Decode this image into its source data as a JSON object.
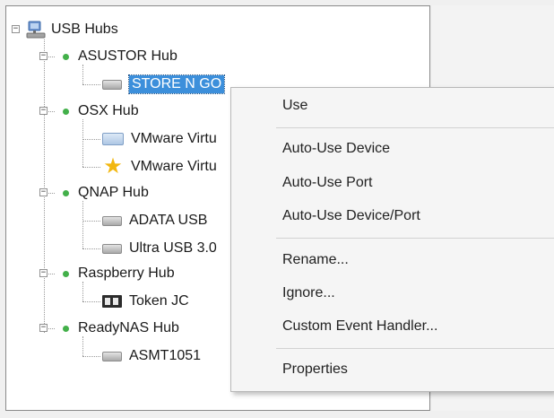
{
  "tree": {
    "root": {
      "label": "USB Hubs"
    },
    "hubs": [
      {
        "label": "ASUSTOR Hub",
        "devices": [
          {
            "label": "STORE N GO",
            "icon": "drive-icon",
            "selected": true
          }
        ]
      },
      {
        "label": "OSX Hub",
        "devices": [
          {
            "label": "VMware Virtu",
            "icon": "vm-icon"
          },
          {
            "label": "VMware Virtu",
            "icon": "star-icon"
          }
        ]
      },
      {
        "label": "QNAP Hub",
        "devices": [
          {
            "label": "ADATA USB",
            "icon": "drive-icon"
          },
          {
            "label": "Ultra USB 3.0",
            "icon": "drive-icon"
          }
        ]
      },
      {
        "label": "Raspberry Hub",
        "devices": [
          {
            "label": "Token JC",
            "icon": "token-icon"
          }
        ]
      },
      {
        "label": "ReadyNAS Hub",
        "devices": [
          {
            "label": "ASMT1051",
            "icon": "drive-icon"
          }
        ]
      }
    ],
    "expander_symbol": "−",
    "hub_status_color": "#43b04a"
  },
  "context_menu": {
    "items": [
      {
        "label": "Use"
      },
      {
        "label": "Auto-Use Device"
      },
      {
        "label": "Auto-Use Port"
      },
      {
        "label": "Auto-Use Device/Port"
      },
      {
        "label": "Rename..."
      },
      {
        "label": "Ignore..."
      },
      {
        "label": "Custom Event Handler..."
      },
      {
        "label": "Properties"
      }
    ]
  },
  "colors": {
    "selection": "#3c8fdb"
  }
}
